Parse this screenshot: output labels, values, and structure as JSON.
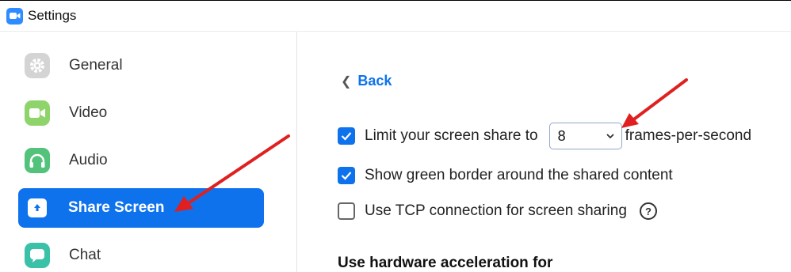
{
  "window": {
    "title": "Settings"
  },
  "sidebar": {
    "items": [
      {
        "label": "General",
        "icon": "gear-icon",
        "color": "#d4d4d4"
      },
      {
        "label": "Video",
        "icon": "video-camera-icon",
        "color": "#8fd46b"
      },
      {
        "label": "Audio",
        "icon": "headphones-icon",
        "color": "#53c27a"
      },
      {
        "label": "Share Screen",
        "icon": "share-screen-icon",
        "color": "#0e72ed",
        "active": true
      },
      {
        "label": "Chat",
        "icon": "chat-bubble-icon",
        "color": "#3cc1a9"
      }
    ]
  },
  "main": {
    "back_label": "Back",
    "limit": {
      "checked": true,
      "label_before": "Limit your screen share to",
      "selected_value": "8",
      "label_after": "frames-per-second"
    },
    "green_border": {
      "checked": true,
      "label": "Show green border around the shared content"
    },
    "tcp": {
      "checked": false,
      "label": "Use TCP connection for screen sharing",
      "help": "?"
    },
    "hw_accel_heading": "Use hardware acceleration for"
  },
  "colors": {
    "accent": "#0e72ed",
    "annotation_arrow": "#e02020"
  }
}
